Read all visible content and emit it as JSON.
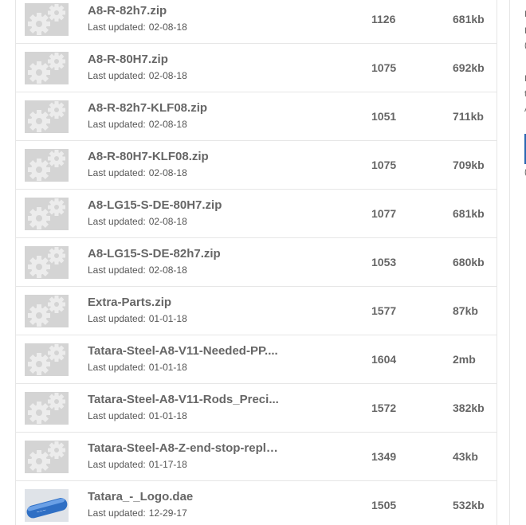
{
  "updated_label": "Last updated:",
  "files": [
    {
      "name": "A8-R-82h7.zip",
      "updated": "02-08-18",
      "downloads": "1126",
      "size": "681kb",
      "thumb": "gear-placeholder"
    },
    {
      "name": "A8-R-80H7.zip",
      "updated": "02-08-18",
      "downloads": "1075",
      "size": "692kb",
      "thumb": "gear-placeholder"
    },
    {
      "name": "A8-R-82h7-KLF08.zip",
      "updated": "02-08-18",
      "downloads": "1051",
      "size": "711kb",
      "thumb": "gear-placeholder"
    },
    {
      "name": "A8-R-80H7-KLF08.zip",
      "updated": "02-08-18",
      "downloads": "1075",
      "size": "709kb",
      "thumb": "gear-placeholder"
    },
    {
      "name": "A8-LG15-S-DE-80H7.zip",
      "updated": "02-08-18",
      "downloads": "1077",
      "size": "681kb",
      "thumb": "gear-placeholder"
    },
    {
      "name": "A8-LG15-S-DE-82h7.zip",
      "updated": "02-08-18",
      "downloads": "1053",
      "size": "680kb",
      "thumb": "gear-placeholder"
    },
    {
      "name": "Extra-Parts.zip",
      "updated": "01-01-18",
      "downloads": "1577",
      "size": "87kb",
      "thumb": "gear-placeholder"
    },
    {
      "name": "Tatara-Steel-A8-V11-Needed-PP....",
      "updated": "01-01-18",
      "downloads": "1604",
      "size": "2mb",
      "thumb": "gear-placeholder"
    },
    {
      "name": "Tatara-Steel-A8-V11-Rods_Preci...",
      "updated": "01-01-18",
      "downloads": "1572",
      "size": "382kb",
      "thumb": "gear-placeholder"
    },
    {
      "name": "Tatara-Steel-A8-Z-end-stop-repli...",
      "updated": "01-17-18",
      "downloads": "1349",
      "size": "43kb",
      "thumb": "gear-placeholder"
    },
    {
      "name": "Tatara_-_Logo.dae",
      "updated": "12-29-17",
      "downloads": "1505",
      "size": "532kb",
      "thumb": "blue-logo-model"
    }
  ],
  "right_panel_fragments": [
    "I",
    "I",
    "(",
    "I",
    "t",
    "A",
    "("
  ],
  "colors": {
    "accent": "#2a67b1",
    "thumb_bg": "#d4d4d4",
    "gear": "#ececec",
    "divider": "#e6e6e6"
  }
}
